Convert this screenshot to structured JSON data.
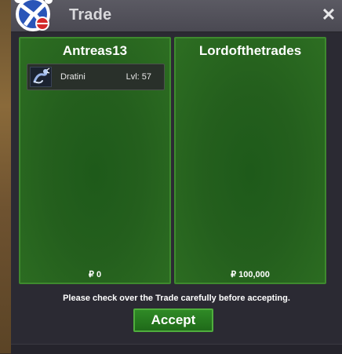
{
  "window": {
    "title": "Trade",
    "close_icon": "close-icon"
  },
  "left_panel": {
    "player_name": "Antreas13",
    "money": "₽ 0",
    "items": [
      {
        "name": "Dratini",
        "level": "Lvl: 57",
        "icon": "dratini-icon"
      }
    ]
  },
  "right_panel": {
    "player_name": "Lordofthetrades",
    "money": "₽ 100,000",
    "items": []
  },
  "footer": {
    "notice": "Please check over the Trade carefully before accepting.",
    "accept_label": "Accept"
  },
  "colors": {
    "panel_green": "#245f1d",
    "panel_border": "#3e8a2e",
    "accept_green": "#2f8a26",
    "window_bg": "#2b2a33",
    "titlebar": "#4a4952"
  }
}
